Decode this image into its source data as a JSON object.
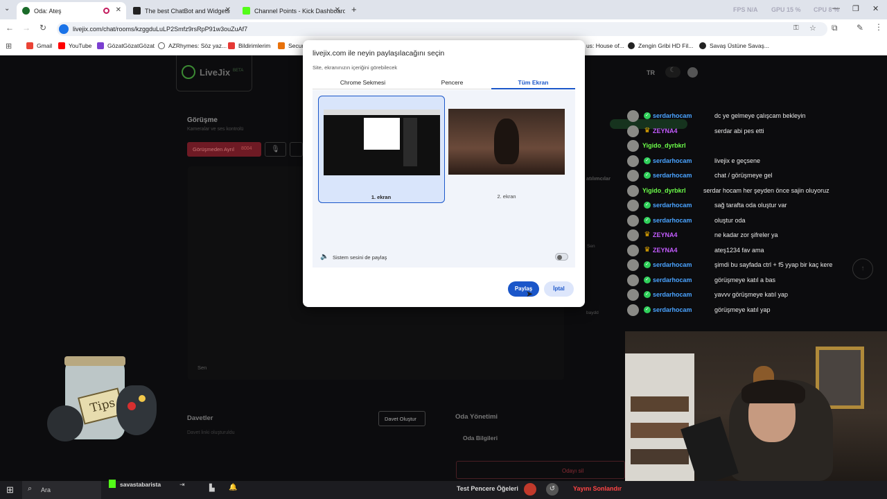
{
  "browser": {
    "tabs": [
      {
        "title": "Oda: Ateş",
        "active": true
      },
      {
        "title": "The best ChatBot and Widgets",
        "active": false
      },
      {
        "title": "Channel Points - Kick Dashboard",
        "active": false
      }
    ],
    "perf": {
      "fps": "FPS N/A",
      "gpu": "GPU 15 %",
      "cpu": "CPU 8 %"
    },
    "url": "livejix.com/chat/rooms/kzggduLuLP2Smfz9rsRpP91w3ouZuAf7",
    "bookmarks": [
      "Gmail",
      "YouTube",
      "GözatGözatGözat",
      "AZRhymes: Söz yaz...",
      "Bildirimlerim",
      "Securi",
      "us: House of...",
      "Zengin Gribi HD Fil...",
      "Savaş Üstüne Savaş..."
    ]
  },
  "app": {
    "logo": "LiveJix",
    "logo_badge": "BETA",
    "lang": "TR",
    "meeting_title": "Görüşme",
    "meeting_subtitle": "Kameralar ve ses kontrolü",
    "leave_button": "Görüşmeden Ayrıl",
    "video_label": "Sen",
    "invites_title": "Davetler",
    "invite_button": "Davet Oluştur",
    "invites_empty": "Davet linki oluşturuldu",
    "room_mgmt_title": "Oda Yönetimi",
    "room_info": "Oda Bilgileri",
    "delete_room": "Odayı sil",
    "participants_label": "atılımcılar",
    "side_sen": "Sen",
    "side_baydd": "baydd"
  },
  "dialog": {
    "title": "livejix.com ile neyin paylaşılacağını seçin",
    "subtitle": "Site, ekranınızın içeriğini görebilecek",
    "tabs": [
      "Chrome Sekmesi",
      "Pencere",
      "Tüm Ekran"
    ],
    "active_tab": "Tüm Ekran",
    "screens": [
      {
        "label": "1. ekran",
        "selected": true
      },
      {
        "label": "2. ekran",
        "selected": false
      }
    ],
    "system_audio": "Sistem sesini de paylaş",
    "system_audio_on": false,
    "share_button": "Paylaş",
    "cancel_button": "İptal"
  },
  "chat": [
    {
      "user": "serdarhocam",
      "badge": "check",
      "color": "#4aa3ff",
      "text": "dc ye gelmeye çalışcam bekleyin"
    },
    {
      "user": "ZEYNA4",
      "badge": "crown",
      "color": "#c45cff",
      "text": "serdar abi pes etti"
    },
    {
      "user": "Yigido_dyrbkrl",
      "badge": "none",
      "color": "#6dff4a",
      "text": ""
    },
    {
      "user": "serdarhocam",
      "badge": "check",
      "color": "#4aa3ff",
      "text": "livejix e geçsene"
    },
    {
      "user": "serdarhocam",
      "badge": "check",
      "color": "#4aa3ff",
      "text": "chat / görüşmeye gel"
    },
    {
      "user": "Yigido_dyrbkrl",
      "badge": "none",
      "color": "#6dff4a",
      "text": "serdar hocam her şeyden önce sajin oluyoruz"
    },
    {
      "user": "serdarhocam",
      "badge": "check",
      "color": "#4aa3ff",
      "text": "sağ tarafta oda oluştur var"
    },
    {
      "user": "serdarhocam",
      "badge": "check",
      "color": "#4aa3ff",
      "text": "oluştur oda"
    },
    {
      "user": "ZEYNA4",
      "badge": "crown",
      "color": "#c45cff",
      "text": "ne kadar zor şifreler ya"
    },
    {
      "user": "ZEYNA4",
      "badge": "crown",
      "color": "#c45cff",
      "text": "ateş1234 fav ama"
    },
    {
      "user": "serdarhocam",
      "badge": "check",
      "color": "#4aa3ff",
      "text": "şimdi bu sayfada ctrl + f5 yyap bir kaç kere"
    },
    {
      "user": "serdarhocam",
      "badge": "check",
      "color": "#4aa3ff",
      "text": "görüşmeye katıl a bas"
    },
    {
      "user": "serdarhocam",
      "badge": "check",
      "color": "#4aa3ff",
      "text": "yavvv görüşmeye katıl yap"
    },
    {
      "user": "serdarhocam",
      "badge": "check",
      "color": "#4aa3ff",
      "text": "görüşmeye katıl yap"
    }
  ],
  "overlay": {
    "tips": "Tips"
  },
  "taskbar": {
    "search": "Ara",
    "app_user": "savastabarista",
    "test_button": "Test Pencere Öğeleri",
    "end_stream": "Yayını Sonlandır"
  }
}
